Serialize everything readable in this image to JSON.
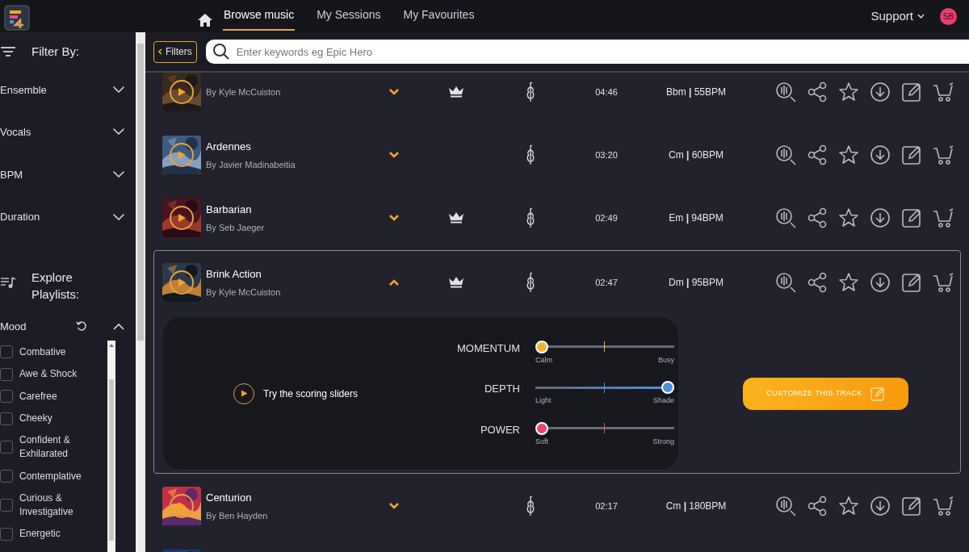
{
  "header": {
    "tabs": [
      {
        "label": "Browse music",
        "selected": true
      },
      {
        "label": "My Sessions",
        "selected": false
      },
      {
        "label": "My Favourites",
        "selected": false
      }
    ],
    "support": "Support",
    "avatar": "SB"
  },
  "sidebar": {
    "title": "Filter By:",
    "filters": [
      {
        "label": "Ensemble",
        "expanded": false
      },
      {
        "label": "Vocals",
        "expanded": false
      },
      {
        "label": "BPM",
        "expanded": false
      },
      {
        "label": "Duration",
        "expanded": false
      }
    ],
    "playlists_title": "Explore Playlists:",
    "mood": {
      "label": "Mood",
      "expanded": true,
      "options": [
        {
          "label": "Combative",
          "checked": false
        },
        {
          "label": "Awe & Shock",
          "checked": false
        },
        {
          "label": "Carefree",
          "checked": false
        },
        {
          "label": "Cheeky",
          "checked": false
        },
        {
          "label": "Confident & Exhilarated",
          "checked": false
        },
        {
          "label": "Contemplative",
          "checked": false
        },
        {
          "label": "Curious & Investigative",
          "checked": false
        },
        {
          "label": "Energetic",
          "checked": false
        }
      ]
    }
  },
  "toolbar": {
    "filters_button": "Filters",
    "search_placeholder": "Enter keywords eg Epic Hero"
  },
  "tracks": [
    {
      "kind": "track",
      "artist": "By Kyle McCuiston",
      "expanded": false,
      "premium": true,
      "duration": "04:46",
      "key_bpm": "Bbm **|** 55BPM"
    },
    {
      "kind": "track",
      "title": "Ardennes",
      "artist": "By Javier Madinabeitia",
      "expanded": false,
      "premium": false,
      "duration": "03:20",
      "key_bpm": "Cm **|** 60BPM"
    },
    {
      "kind": "track",
      "title": "Barbarian",
      "artist": "By Seb Jaeger",
      "expanded": false,
      "premium": true,
      "duration": "02:49",
      "key_bpm": "Em **|** 94BPM"
    },
    {
      "kind": "track",
      "title": "Brink Action",
      "artist": "By Kyle McCuiston",
      "expanded": true,
      "premium": true,
      "duration": "02:47",
      "key_bpm": "Dm **|** 95BPM",
      "scoring": {
        "prompt": "Try the scoring sliders",
        "button": "CUSTOMIZE THIS TRACK",
        "sliders": [
          {
            "name": "MOMENTUM",
            "low": "Calm",
            "high": "Busy",
            "level": 0,
            "color": "#f6b332"
          },
          {
            "name": "DEPTH",
            "low": "Light",
            "high": "Shade",
            "level": 1,
            "color": "#4a90e2"
          },
          {
            "name": "POWER",
            "low": "Soft",
            "high": "Strong",
            "level": 0,
            "color": "#e8486e"
          }
        ]
      }
    },
    {
      "kind": "track",
      "title": "Centurion",
      "artist": "By Ben Hayden",
      "expanded": false,
      "premium": false,
      "duration": "02:17",
      "key_bpm": "Cm **|** 180BPM"
    },
    {
      "kind": "partial"
    }
  ]
}
